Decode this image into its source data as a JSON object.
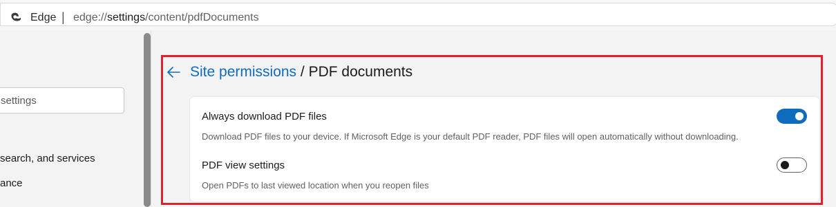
{
  "browser": {
    "app_name": "Edge",
    "separator": "|",
    "url_prefix": "edge://",
    "url_host": "settings",
    "url_path": "/content/pdfDocuments"
  },
  "sidebar": {
    "search_placeholder": "settings",
    "items": [
      {
        "label": "search, and services"
      },
      {
        "label": "ance"
      }
    ]
  },
  "page": {
    "breadcrumb_parent": "Site permissions",
    "breadcrumb_separator": " / ",
    "title": "PDF documents"
  },
  "settings": [
    {
      "title": "Always download PDF files",
      "description": "Download PDF files to your device. If Microsoft Edge is your default PDF reader, PDF files will open automatically without downloading.",
      "enabled": true
    },
    {
      "title": "PDF view settings",
      "description": "Open PDFs to last viewed location when you reopen files",
      "enabled": false
    }
  ],
  "colors": {
    "accent": "#0f6cbd",
    "highlight_border": "#e41f2b"
  }
}
